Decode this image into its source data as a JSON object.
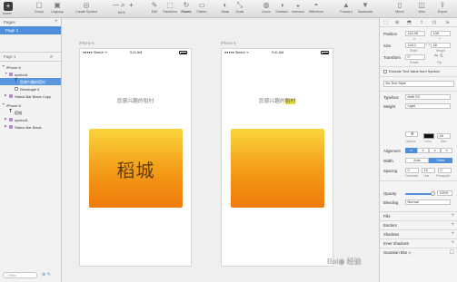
{
  "toolbar": {
    "insert": "Insert",
    "items": [
      {
        "label": "Group",
        "icon": "group-icon"
      },
      {
        "label": "Ungroup",
        "icon": "ungroup-icon"
      },
      {
        "label": "Create Symbol",
        "icon": "symbol-icon"
      },
      {
        "label": "Edit",
        "icon": "edit-icon"
      },
      {
        "label": "Transform",
        "icon": "transform-icon"
      },
      {
        "label": "Rotate",
        "icon": "rotate-icon"
      },
      {
        "label": "Flatten",
        "icon": "flatten-icon"
      },
      {
        "label": "Mask",
        "icon": "mask-icon"
      },
      {
        "label": "Scale",
        "icon": "scale-icon"
      },
      {
        "label": "Union",
        "icon": "union-icon"
      },
      {
        "label": "Subtract",
        "icon": "subtract-icon"
      },
      {
        "label": "Intersect",
        "icon": "intersect-icon"
      },
      {
        "label": "Difference",
        "icon": "difference-icon"
      },
      {
        "label": "Forward",
        "icon": "forward-icon"
      },
      {
        "label": "Backward",
        "icon": "backward-icon"
      },
      {
        "label": "Mirror",
        "icon": "mirror-icon"
      },
      {
        "label": "View",
        "icon": "view-icon"
      },
      {
        "label": "Export",
        "icon": "export-icon"
      }
    ],
    "zoom": "84%"
  },
  "sidebar": {
    "pages_title": "Pages",
    "page1": "Page 1",
    "layers_title": "Page 1",
    "layers": [
      {
        "label": "iPhone 6",
        "indent": 0
      },
      {
        "label": "symbol1",
        "indent": 1
      },
      {
        "label": "您感兴趣的稻村",
        "indent": 2
      },
      {
        "label": "Rectangle 6",
        "indent": 2
      },
      {
        "label": "Status Bar Black Copy",
        "indent": 1
      },
      {
        "label": "iPhone 6",
        "indent": 0
      },
      {
        "label": "稻城",
        "indent": 1
      },
      {
        "label": "symbol1",
        "indent": 1
      },
      {
        "label": "Status Bar Black",
        "indent": 1
      }
    ],
    "filter_placeholder": "Filter"
  },
  "canvas": {
    "artboard_left": {
      "label": "iPhone 6",
      "carrier": "●●●●● Sketch ᯤ",
      "time": "9:41 AM",
      "headline": "您感兴趣的稻村",
      "card_text": "稻城"
    },
    "artboard_right": {
      "label": "iPhone 6",
      "carrier": "●●●●● Sketch ᯤ",
      "time": "9:41 AM",
      "headline_plain": "您感兴趣的",
      "headline_highlight": "稻村"
    }
  },
  "inspector": {
    "top": [
      "⬚",
      "⊞",
      "⬒",
      "⇧",
      "⊡",
      "⇲"
    ],
    "position_label": "Position",
    "pos_x": "115.45",
    "pos_y": "108",
    "pos_x_sub": "X",
    "pos_y_sub": "Y",
    "size_label": "Size",
    "width": "144.1",
    "height": "18",
    "width_sub": "Width",
    "height_sub": "Height",
    "transform_label": "Transform",
    "rotate": "0°",
    "rotate_sub": "Rotate",
    "flip_sub": "Flip",
    "exclude_text": "Exclude Text Value from Symbol",
    "text_style": "No Text Style",
    "typeface_label": "Typeface",
    "typeface": "Heiti SC",
    "weight_label": "Weight",
    "weight": "Light",
    "font_size": "18",
    "options_sub": "Options",
    "color_sub": "Color",
    "size_sub": "Size",
    "alignment_label": "Alignment",
    "width_mode_label": "Width",
    "width_auto": "Auto",
    "width_fixed": "Fixed",
    "spacing_label": "Spacing",
    "char_spacing": "0",
    "line_spacing": "19",
    "para_spacing": "0",
    "char_sub": "Character",
    "line_sub": "Line",
    "para_sub": "Paragraph",
    "opacity_label": "Opacity",
    "opacity_value": "100%",
    "opacity_level": 1.0,
    "blending_label": "Blending",
    "blending": "Normal",
    "sections": [
      "Fills",
      "Borders",
      "Shadows",
      "Inner Shadows",
      "Gaussian Blur ◇"
    ]
  },
  "colors": {
    "accent": "#4e8edb",
    "card_top": "#f9d53c",
    "card_bottom": "#ef7b0c",
    "highlight": "#f5e03a"
  }
}
